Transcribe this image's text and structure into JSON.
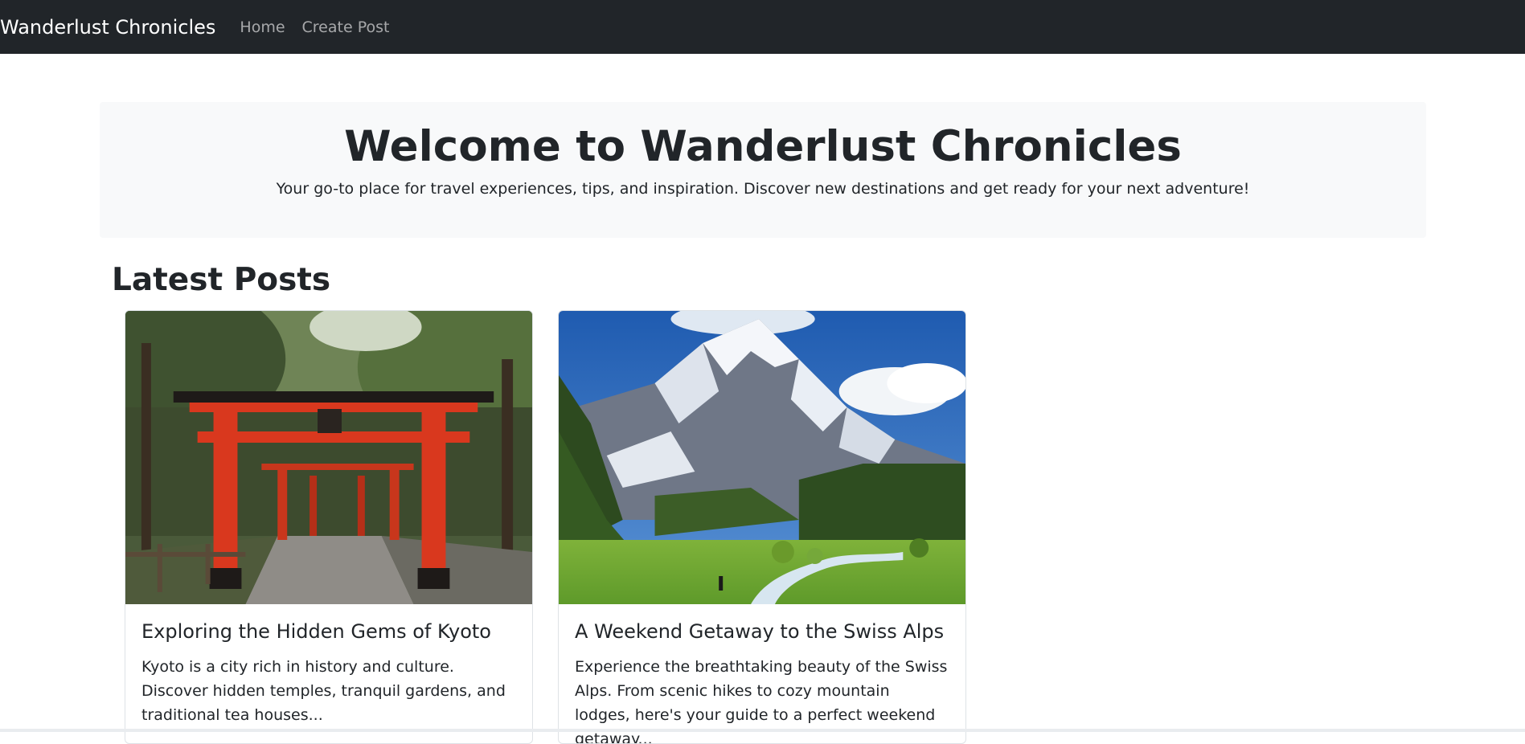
{
  "navbar": {
    "brand": "Wanderlust Chronicles",
    "links": [
      "Home",
      "Create Post"
    ]
  },
  "hero": {
    "title": "Welcome to Wanderlust Chronicles",
    "subtitle": "Your go-to place for travel experiences, tips, and inspiration. Discover new destinations and get ready for your next adventure!"
  },
  "latest": {
    "heading": "Latest Posts",
    "posts": [
      {
        "title": "Exploring the Hidden Gems of Kyoto",
        "excerpt": "Kyoto is a city rich in history and culture. Discover hidden temples, tranquil gardens, and traditional tea houses..."
      },
      {
        "title": "A Weekend Getaway to the Swiss Alps",
        "excerpt": "Experience the breathtaking beauty of the Swiss Alps. From scenic hikes to cozy mountain lodges, here's your guide to a perfect weekend getaway..."
      }
    ]
  },
  "colors": {
    "navbar_bg": "#212529",
    "hero_bg": "#f8f9fa",
    "torii_red": "#d9381e",
    "sky_blue": "#2b6cc4"
  }
}
